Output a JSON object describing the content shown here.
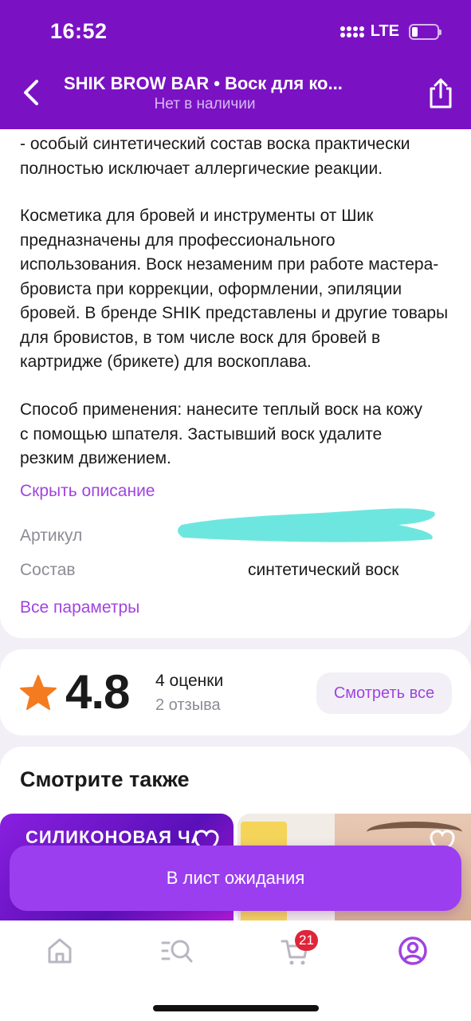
{
  "status_bar": {
    "time": "16:52",
    "network": "LTE"
  },
  "header": {
    "title": "SHIK BROW BAR • Воск для ко...",
    "subtitle": "Нет в наличии"
  },
  "description": {
    "paragraph1": "- особый синтетический состав воска практически полностью исключает аллергические реакции.",
    "paragraph2": "Косметика для бровей и инструменты от Шик предназначены для профессионального использования. Воск незаменим при работе мастера-бровиста при коррекции, оформлении, эпиляции бровей. В бренде SHIK представлены и другие товары для бровистов, в том числе воск для бровей в картридже (брикете) для воскоплава.",
    "paragraph3": "Способ применения: нанесите теплый воск на кожу с помощью шпателя. Застывший воск удалите резким движением.",
    "hide_link": "Скрыть описание"
  },
  "params": [
    {
      "label": "Артикул",
      "value": ""
    },
    {
      "label": "Состав",
      "value": "синтетический воск"
    }
  ],
  "all_params_link": "Все параметры",
  "rating": {
    "score": "4.8",
    "ratings_count": "4 оценки",
    "reviews_count": "2 отзыва",
    "see_all": "Смотреть все"
  },
  "see_also": {
    "title": "Смотрите также",
    "product1_text": "СИЛИКОНОВАЯ ЧАШ"
  },
  "cta": {
    "label": "В лист ожидания"
  },
  "tabbar": {
    "cart_badge": "21"
  },
  "colors": {
    "brand": "#7a12c4",
    "accent": "#a044e0",
    "cta": "#9b3ef0",
    "badge": "#e0243a",
    "star": "#f47b20"
  }
}
